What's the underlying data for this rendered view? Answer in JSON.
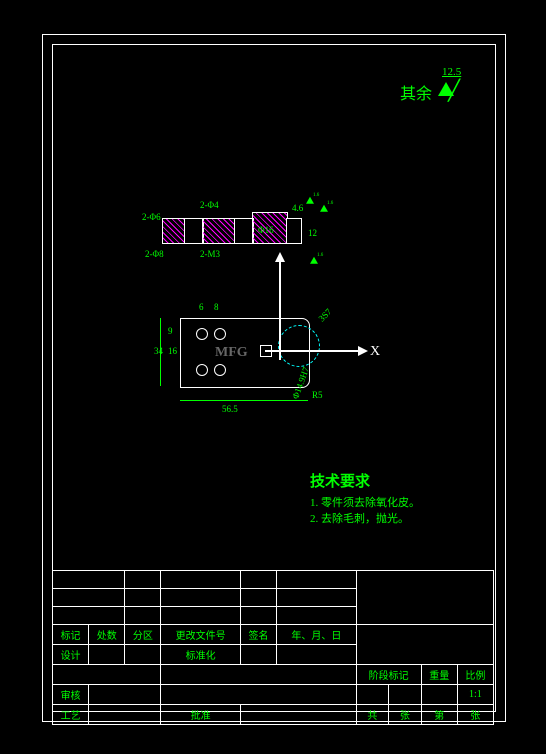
{
  "surface": {
    "label": "其余",
    "value": "12.5"
  },
  "section": {
    "dims": [
      "2-Φ6",
      "2-Φ4",
      "2-Φ8",
      "2-M3",
      "Φ16",
      "4.6",
      "12"
    ],
    "rough": [
      "1.6",
      "1.6",
      "1.6"
    ]
  },
  "plan": {
    "axis_x": "X",
    "dims": [
      "6",
      "8",
      "9",
      "16",
      "34",
      "56.5",
      "R5",
      "3S7",
      "Φ14.9H7"
    ]
  },
  "tech": {
    "title": "技术要求",
    "items": [
      "1. 零件须去除氧化皮。",
      "2. 去除毛刺，抛光。"
    ]
  },
  "titleblock": {
    "row1": [
      "标记",
      "处数",
      "分区",
      "更改文件号",
      "签名",
      "年、月、日"
    ],
    "row2": [
      "设计",
      "",
      "",
      "标准化",
      "",
      "",
      "阶段标记",
      "重量",
      "比例"
    ],
    "row3": [
      "审核",
      "",
      "",
      "",
      "",
      "",
      "",
      "",
      "1:1"
    ],
    "row4": [
      "工艺",
      "",
      "",
      "批准",
      "",
      "",
      "共",
      "张",
      "第",
      "张"
    ]
  },
  "watermark": "MFG"
}
